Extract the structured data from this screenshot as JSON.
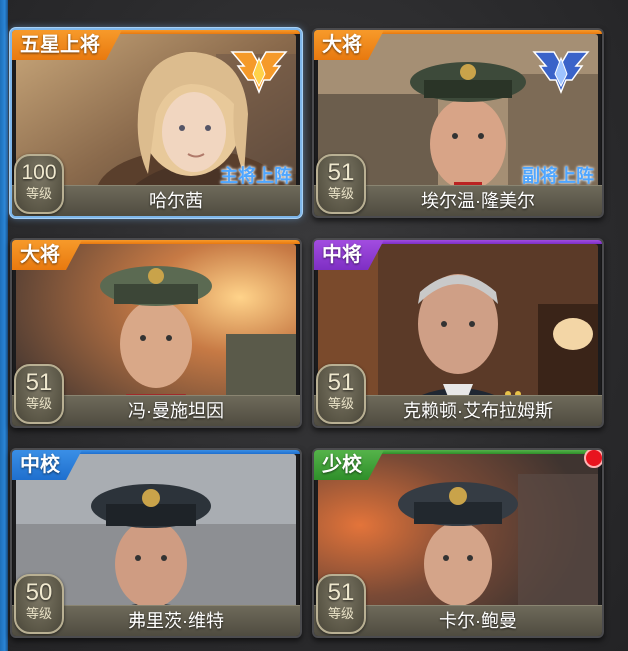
{
  "generals": [
    {
      "rank": "五星上将",
      "rank_color": "#f08a1c",
      "name": "哈尔茜",
      "level": "100",
      "level_label": "等级",
      "role": "主将上阵",
      "emblem": "gold-wings-emblem-icon",
      "selected": true
    },
    {
      "rank": "大将",
      "rank_color": "#f08a1c",
      "name": "埃尔温·隆美尔",
      "level": "51",
      "level_label": "等级",
      "role": "副将上阵",
      "emblem": "blue-wings-emblem-icon"
    },
    {
      "rank": "大将",
      "rank_color": "#f08a1c",
      "name": "冯·曼施坦因",
      "level": "51",
      "level_label": "等级"
    },
    {
      "rank": "中将",
      "rank_color": "#9a46dc",
      "name": "克赖顿·艾布拉姆斯",
      "level": "51",
      "level_label": "等级"
    },
    {
      "rank": "中校",
      "rank_color": "#2f86e0",
      "name": "弗里茨·维特",
      "level": "50",
      "level_label": "等级"
    },
    {
      "rank": "少校",
      "rank_color": "#4aa843",
      "name": "卡尔·鲍曼",
      "level": "51",
      "level_label": "等级",
      "notification": true
    }
  ]
}
